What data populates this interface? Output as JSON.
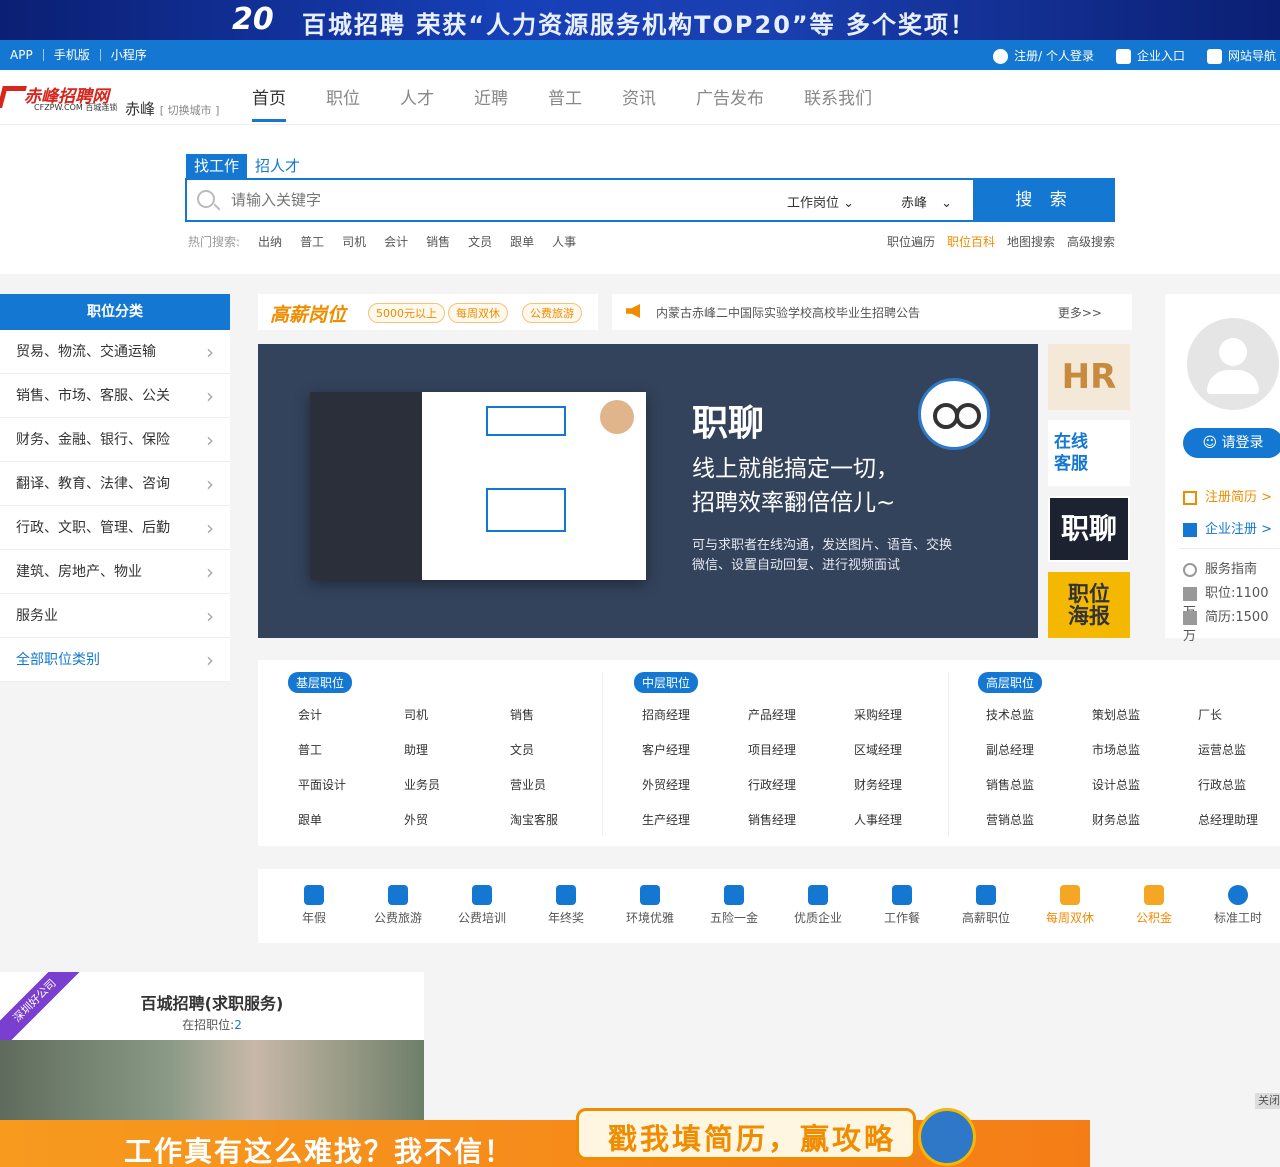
{
  "top_banner": {
    "number": "20",
    "text": "百城招聘 荣获“人力资源服务机构TOP20”等 多个奖项！"
  },
  "util": {
    "left": [
      "APP",
      "手机版",
      "小程序"
    ],
    "register": "注册/ 个人登录",
    "company": "企业入口",
    "sitenav": "网站导航"
  },
  "logo": {
    "main": "赤峰招聘网",
    "sub": "CFZPW.COM 百城连锁"
  },
  "city": {
    "name": "赤峰",
    "switch": "[ 切换城市 ]"
  },
  "nav": [
    "首页",
    "职位",
    "人才",
    "近聘",
    "普工",
    "资讯",
    "广告发布",
    "联系我们"
  ],
  "search": {
    "tabs": [
      "找工作",
      "招人才"
    ],
    "placeholder": "请输入关键字",
    "type": "工作岗位",
    "city": "赤峰",
    "button": "搜 索",
    "hot_label": "热门搜索:",
    "hot": [
      "出纳",
      "普工",
      "司机",
      "会计",
      "销售",
      "文员",
      "跟单",
      "人事"
    ],
    "links": [
      "职位遍历",
      "职位百科",
      "地图搜索",
      "高级搜索"
    ]
  },
  "categories": {
    "title": "职位分类",
    "items": [
      "贸易、物流、交通运输",
      "销售、市场、客服、公关",
      "财务、金融、银行、保险",
      "翻译、教育、法律、咨询",
      "行政、文职、管理、后勤",
      "建筑、房地产、物业",
      "服务业",
      "全部职位类别"
    ]
  },
  "highpay": {
    "label": "高薪岗位",
    "tags": [
      "5000元以上",
      "每周双休",
      "公费旅游"
    ]
  },
  "notice": {
    "text": "内蒙古赤峰二中国际实验学校高校毕业生招聘公告",
    "more": "更多>>"
  },
  "banner": {
    "title": "职聊",
    "sub1": "线上就能搞定一切，",
    "sub2": "招聘效率翻倍倍儿~",
    "desc1": "可与求职者在线沟通，发送图片、语音、交换",
    "desc2": "微信、设置自动回复、进行视频面试"
  },
  "tiles": {
    "hr": "HR",
    "kf": "在线\n客服",
    "zl": "职聊",
    "hb1": "职位",
    "hb2": "海报"
  },
  "user": {
    "login": "请登录",
    "resume": "注册简历 >",
    "company": "企业注册 >",
    "guide": "服务指南",
    "jobs": "职位:1100万",
    "resumes": "简历:1500万"
  },
  "positions": {
    "junior": {
      "label": "基层职位",
      "items": [
        "会计",
        "司机",
        "销售",
        "普工",
        "助理",
        "文员",
        "平面设计",
        "业务员",
        "营业员",
        "跟单",
        "外贸",
        "淘宝客服"
      ]
    },
    "middle": {
      "label": "中层职位",
      "items": [
        "招商经理",
        "产品经理",
        "采购经理",
        "客户经理",
        "项目经理",
        "区域经理",
        "外贸经理",
        "行政经理",
        "财务经理",
        "生产经理",
        "销售经理",
        "人事经理"
      ]
    },
    "senior": {
      "label": "高层职位",
      "items": [
        "技术总监",
        "策划总监",
        "厂长",
        "副总经理",
        "市场总监",
        "运营总监",
        "销售总监",
        "设计总监",
        "行政总监",
        "营销总监",
        "财务总监",
        "总经理助理"
      ]
    }
  },
  "benefits": [
    "年假",
    "公费旅游",
    "公费培训",
    "年终奖",
    "环境优雅",
    "五险一金",
    "优质企业",
    "工作餐",
    "高薪职位",
    "每周双休",
    "公积金",
    "标准工时"
  ],
  "company": {
    "ribbon": "深圳好公司",
    "name": "百城招聘(求职服务)",
    "count_label": "在招职位:",
    "count": "2"
  },
  "bottom_ad": {
    "left": "工作真有这么难找？我不信！",
    "right": "戳我填简历，赢攻略"
  },
  "close": "关闭"
}
